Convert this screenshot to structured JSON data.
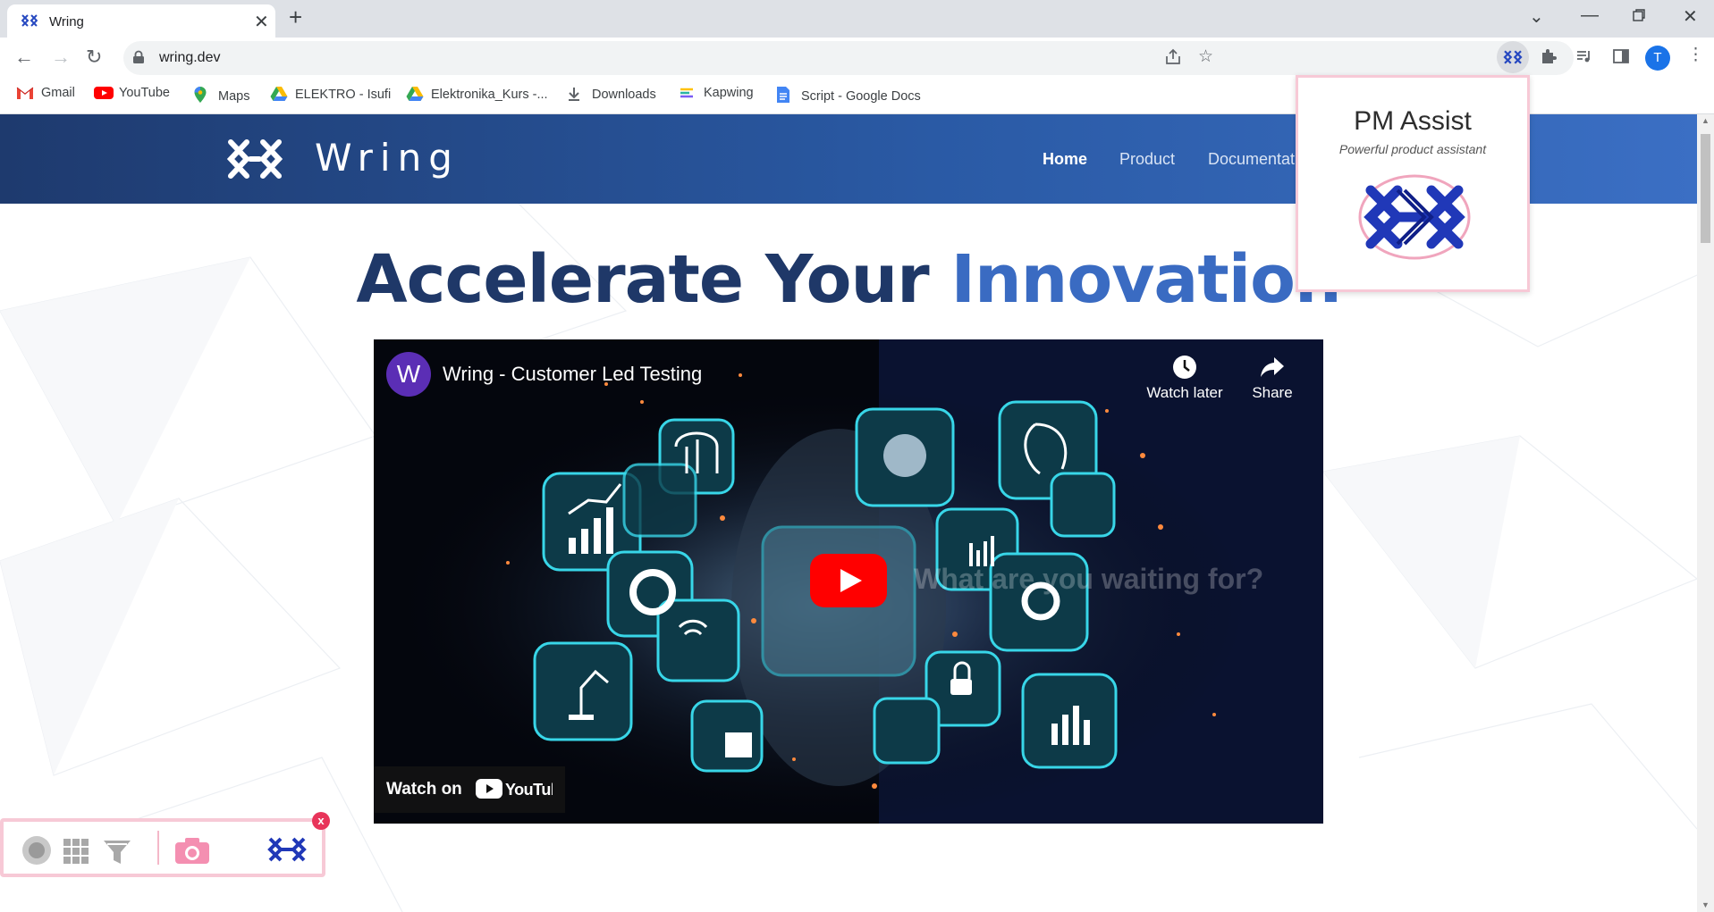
{
  "tab": {
    "title": "Wring",
    "close_icon": "close-icon",
    "new_tab_icon": "plus-icon"
  },
  "window": {
    "controls": [
      "chevron-down-icon",
      "minimize-icon",
      "restore-icon",
      "close-icon"
    ]
  },
  "toolbar": {
    "url": "wring.dev",
    "avatar_letter": "T"
  },
  "bookmarks": [
    {
      "label": "Gmail",
      "icon": "gmail-icon"
    },
    {
      "label": "YouTube",
      "icon": "youtube-icon"
    },
    {
      "label": "Maps",
      "icon": "maps-icon"
    },
    {
      "label": "ELEKTRO - Isufi",
      "icon": "drive-icon"
    },
    {
      "label": "Elektronika_Kurs -...",
      "icon": "drive-icon"
    },
    {
      "label": "Downloads",
      "icon": "download-icon"
    },
    {
      "label": "Kapwing",
      "icon": "kapwing-icon"
    },
    {
      "label": "Script - Google Docs",
      "icon": "docs-icon"
    }
  ],
  "site": {
    "brand": "Wring",
    "nav": [
      "Home",
      "Product",
      "Documentat"
    ],
    "headline_part1": "Accelerate Your",
    "headline_part2": "Innovation"
  },
  "video": {
    "channel_letter": "W",
    "title": "Wring - Customer Led Testing",
    "watch_later": "Watch later",
    "share": "Share",
    "watch_on": "Watch on",
    "overlay_text": "What are you waiting for?"
  },
  "popup": {
    "title": "PM Assist",
    "subtitle": "Powerful product assistant"
  },
  "floating_toolbar": {
    "close_label": "x"
  },
  "colors": {
    "nav_dark": "#1e3a6e",
    "nav_light": "#3b6fc4",
    "headline_dark": "#1f3868",
    "headline_blue": "#3a6bc2",
    "popup_border": "#f7c9d6",
    "accent_pink": "#e8345a"
  }
}
